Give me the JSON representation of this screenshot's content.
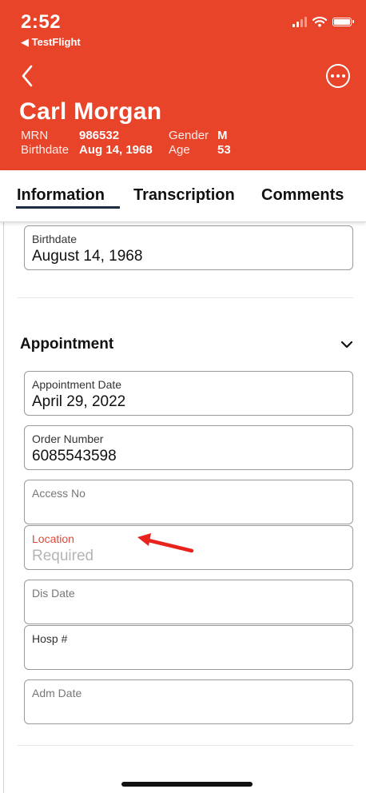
{
  "status_bar": {
    "time": "2:52",
    "back_app": "◀ TestFlight"
  },
  "patient": {
    "name": "Carl Morgan",
    "mrn_label": "MRN",
    "mrn": "986532",
    "gender_label": "Gender",
    "gender": "M",
    "birthdate_label": "Birthdate",
    "birthdate": "Aug 14, 1968",
    "age_label": "Age",
    "age": "53"
  },
  "tabs": [
    {
      "label": "Information"
    },
    {
      "label": "Transcription"
    },
    {
      "label": "Comments"
    }
  ],
  "fields": {
    "birthdate": {
      "label": "Birthdate",
      "value": "August 14, 1968"
    }
  },
  "appointment": {
    "title": "Appointment",
    "fields": [
      {
        "label": "Appointment Date",
        "value": "April 29, 2022"
      },
      {
        "label": "Order Number",
        "value": "6085543598"
      },
      {
        "label": "Access No",
        "value": ""
      },
      {
        "label": "Location",
        "value": "Required"
      },
      {
        "label": "Dis Date",
        "value": ""
      },
      {
        "label": "Hosp #",
        "value": ""
      },
      {
        "label": "Adm Date",
        "value": ""
      }
    ]
  },
  "colors": {
    "header": "#e7442a",
    "required": "#d94b3c",
    "tab_underline": "#1c2b3f",
    "annotation_arrow": "#e8231d"
  },
  "icons": {
    "back": "chevron-left-icon",
    "more": "more-horizontal-circle-icon",
    "section_toggle": "chevron-down-icon",
    "annotation": "arrow-left-icon"
  }
}
